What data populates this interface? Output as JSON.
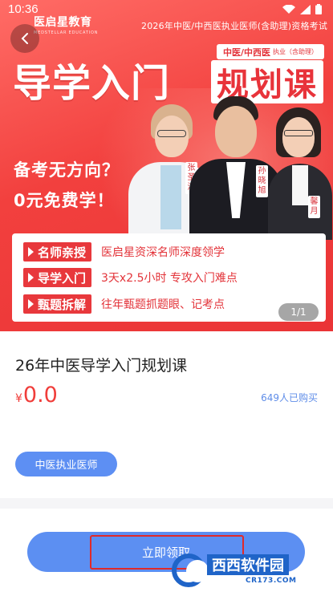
{
  "status_bar": {
    "time": "10:36"
  },
  "banner": {
    "brand_name": "医启星教育",
    "brand_sub": "MEDSTELLAR EDUCATION",
    "exam_title": "2026年中医/中西医执业医师(含助理)资格考试",
    "major_chip": "中医/中西医",
    "major_chip_sub": "执业（含助理）",
    "headline": "导学入门",
    "headline_boxed": "规划课",
    "slogan_1": "备考无方向？",
    "slogan_2": "0元免费学！",
    "teachers": [
      "张圣淇",
      "孙晓旭",
      "馨月"
    ],
    "features": [
      {
        "tag": "名师亲授",
        "text": "医启星资深名师深度领学"
      },
      {
        "tag": "导学入门",
        "text": "3天x2.5小时  专攻入门难点"
      },
      {
        "tag": "甄题拆解",
        "text": "往年甄题抓题眼、记考点"
      }
    ],
    "pager": "1/1"
  },
  "course": {
    "title": "26年中医导学入门规划课",
    "currency": "¥",
    "price": "0.0",
    "buyers": "649人已购买",
    "tag": "中医执业医师"
  },
  "cta": {
    "label": "立即领取"
  },
  "watermark": {
    "text": "西西软件园",
    "url": "CR173.COM"
  },
  "colors": {
    "banner_red": "#f2403e",
    "accent_blue": "#5c8ff2",
    "price_red": "#f03d3a"
  }
}
